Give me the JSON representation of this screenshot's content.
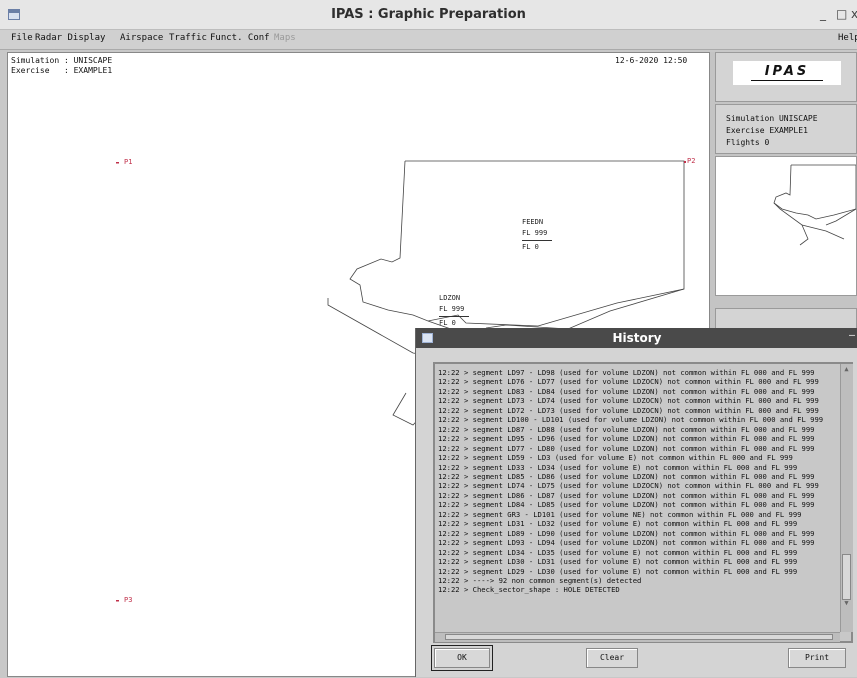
{
  "window": {
    "title": "IPAS : Graphic Preparation",
    "minimize": "_",
    "maximize": "□",
    "close": "x"
  },
  "menu": {
    "file": "File",
    "radar_display": "Radar Display",
    "airspace": "Airspace",
    "traffic": "Traffic",
    "funct_conf": "Funct. Conf",
    "maps": "Maps",
    "help": "Help"
  },
  "radar": {
    "simulation_line": "Simulation : UNISCAPE",
    "exercise_line": "Exercise   : EXAMPLE1",
    "datetime": "12-6-2020 12:50",
    "points": {
      "p1": "P1",
      "p2": "P2",
      "p3": "P3"
    },
    "sectors": {
      "feedn": {
        "name": "FEEDN",
        "fl_top": "FL 999",
        "fl_bottom": "FL 0"
      },
      "ldzon": {
        "name": "LDZON",
        "fl_top": "FL 999",
        "fl_bottom": "FL 0"
      }
    }
  },
  "side_panel": {
    "logo": "IPAS",
    "simulation": "Simulation UNISCAPE",
    "exercise": "Exercise EXAMPLE1",
    "flights": "Flights 0"
  },
  "history": {
    "title": "History",
    "log": [
      "12:22 > segment LD97 - LD98 (used for volume LDZON) not common within FL 000 and FL 999",
      "12:22 > segment LD76 - LD77 (used for volume LDZOCN) not common within FL 000 and FL 999",
      "12:22 > segment LD83 - LD84 (used for volume LDZON) not common within FL 000 and FL 999",
      "12:22 > segment LD73 - LD74 (used for volume LDZOCN) not common within FL 000 and FL 999",
      "12:22 > segment LD72 - LD73 (used for volume LDZOCN) not common within FL 000 and FL 999",
      "12:22 > segment LD100 - LD101 (used for volume LDZON) not common within FL 000 and FL 999",
      "12:22 > segment LD87 - LD88 (used for volume LDZON) not common within FL 000 and FL 999",
      "12:22 > segment LD95 - LD96 (used for volume LDZON) not common within FL 000 and FL 999",
      "12:22 > segment LD77 - LD80 (used for volume LDZON) not common within FL 000 and FL 999",
      "12:22 > segment LD59 - LD3 (used for volume E) not common within FL 000 and FL 999",
      "12:22 > segment LD33 - LD34 (used for volume E) not common within FL 000 and FL 999",
      "12:22 > segment LD85 - LD86 (used for volume LDZON) not common within FL 000 and FL 999",
      "12:22 > segment LD74 - LD75 (used for volume LDZOCN) not common within FL 000 and FL 999",
      "12:22 > segment LD86 - LD87 (used for volume LDZON) not common within FL 000 and FL 999",
      "12:22 > segment LD84 - LD85 (used for volume LDZON) not common within FL 000 and FL 999",
      "12:22 > segment GR3 - LD101 (used for volume NE) not common within FL 000 and FL 999",
      "12:22 > segment LD31 - LD32 (used for volume E) not common within FL 000 and FL 999",
      "12:22 > segment LD89 - LD90 (used for volume LDZON) not common within FL 000 and FL 999",
      "12:22 > segment LD93 - LD94 (used for volume LDZON) not common within FL 000 and FL 999",
      "12:22 > segment LD34 - LD35 (used for volume E) not common within FL 000 and FL 999",
      "12:22 > segment LD30 - LD31 (used for volume E) not common within FL 000 and FL 999",
      "12:22 > segment LD29 - LD30 (used for volume E) not common within FL 000 and FL 999",
      "12:22 > ----> 92 non common segment(s) detected",
      "12:22 > Check_sector_shape : HOLE DETECTED"
    ],
    "buttons": {
      "ok": "OK",
      "clear": "Clear",
      "print": "Print"
    }
  }
}
